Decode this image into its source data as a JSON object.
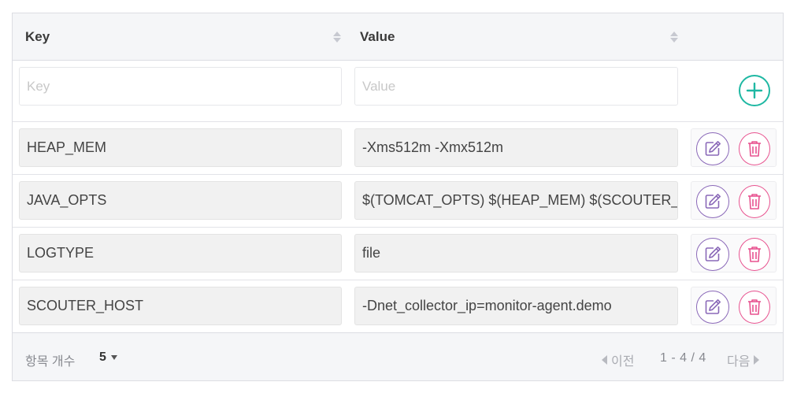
{
  "colors": {
    "accent_add": "#1fb8a3",
    "edit": "#8a68b8",
    "delete": "#e8528f",
    "header_bg": "#f5f6f8"
  },
  "table": {
    "columns": [
      {
        "label": "Key",
        "sort_icon": "sort-icon"
      },
      {
        "label": "Value",
        "sort_icon": "sort-icon"
      }
    ],
    "new_row": {
      "key_placeholder": "Key",
      "value_placeholder": "Value",
      "add_icon": "plus-circle-icon"
    },
    "rows": [
      {
        "key": "HEAP_MEM",
        "value": "-Xms512m -Xmx512m"
      },
      {
        "key": "JAVA_OPTS",
        "value": "$(TOMCAT_OPTS) $(HEAP_MEM) $(SCOUTER_OPTS)"
      },
      {
        "key": "LOGTYPE",
        "value": "file"
      },
      {
        "key": "SCOUTER_HOST",
        "value": "-Dnet_collector_ip=monitor-agent.demo"
      }
    ],
    "row_actions": {
      "edit_icon": "edit-icon",
      "delete_icon": "trash-icon"
    }
  },
  "footer": {
    "page_size_label": "항목 개수",
    "page_size_value": "5",
    "prev_label": "이전",
    "range": "1 - 4 / 4",
    "next_label": "다음"
  }
}
